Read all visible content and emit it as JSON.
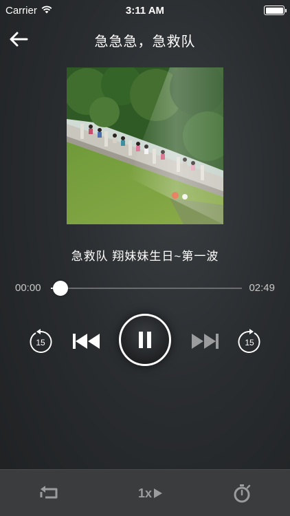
{
  "status_bar": {
    "carrier": "Carrier",
    "time": "3:11 AM"
  },
  "nav": {
    "title": "急急急，急救队"
  },
  "track": {
    "title": "急救队  翔妹妹生日~第一波",
    "elapsed": "00:00",
    "total": "02:49",
    "progress_fraction": 0.02
  },
  "controls": {
    "skip_back_seconds": "15",
    "skip_forward_seconds": "15",
    "state": "playing"
  },
  "bottom_bar": {
    "speed_label": "1x"
  },
  "icons": {
    "back": "back-arrow-icon",
    "skip_back": "rewind-15-icon",
    "prev": "previous-track-icon",
    "pause": "pause-icon",
    "next": "next-track-icon",
    "skip_forward": "forward-15-icon",
    "repeat": "repeat-icon",
    "speed": "play-speed-icon",
    "timer": "stopwatch-icon",
    "wifi": "wifi-icon",
    "battery": "battery-icon"
  },
  "colors": {
    "background": "#2a2d30",
    "bottom_bar": "#3a3c3e",
    "accent": "#ffffff",
    "muted": "#9a9c9e"
  }
}
